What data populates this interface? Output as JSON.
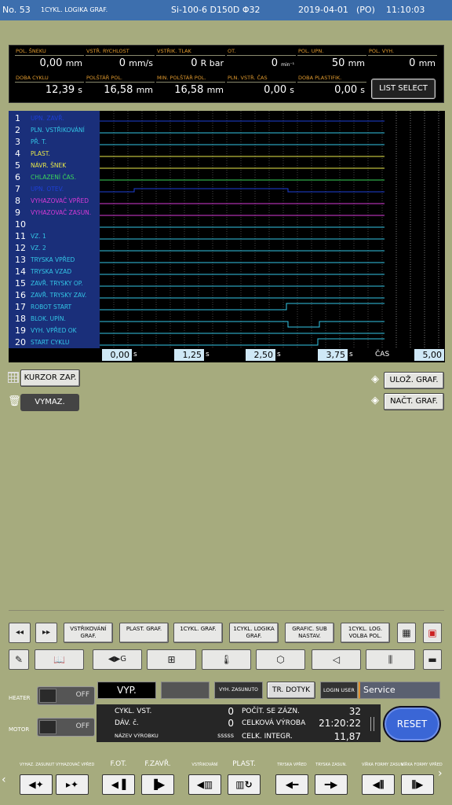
{
  "header": {
    "no": "No. 53",
    "mode": "1CYKL. LOGIKA GRAF.",
    "machine": "Si-100-6  D150D Φ32",
    "date": "2019-04-01",
    "day": "(PO)",
    "time": "11:10:03"
  },
  "params": [
    {
      "label": "POL. ŠNEKU",
      "value": "0,00",
      "unit": "mm"
    },
    {
      "label": "VSTŘ. RYCHLOST",
      "value": "0",
      "unit": "mm/s"
    },
    {
      "label": "VSTŘIK. TLAK",
      "value": "0",
      "unit": "R bar"
    },
    {
      "label": "OT.",
      "value": "0",
      "unit": "min⁻¹"
    },
    {
      "label": "POL. UPN.",
      "value": "50",
      "unit": "mm"
    },
    {
      "label": "POL. VYH.",
      "value": "0",
      "unit": "mm"
    },
    {
      "label": "DOBA CYKLU",
      "value": "12,39",
      "unit": "s"
    },
    {
      "label": "POLŠTÁŘ POL.",
      "value": "16,58",
      "unit": "mm"
    },
    {
      "label": "MIN. POLŠTÁŘ POL.",
      "value": "16,58",
      "unit": "mm"
    },
    {
      "label": "PLN. VSTŘ. ČAS",
      "value": "0,00",
      "unit": "s"
    },
    {
      "label": "DOBA PLASTIFIK.",
      "value": "0,00",
      "unit": "s"
    }
  ],
  "list_select": "LIST SELECT",
  "signals": [
    {
      "n": "1",
      "name": "UPN. ZAVŘ.",
      "color": "#1e3fd6"
    },
    {
      "n": "2",
      "name": "PLN. VSTŘIKOVÁNÍ",
      "color": "#33c6e6"
    },
    {
      "n": "3",
      "name": "PŘ. T.",
      "color": "#33c6e6"
    },
    {
      "n": "4",
      "name": "PLAST.",
      "color": "#e8e84a"
    },
    {
      "n": "5",
      "name": "NÁVR. ŠNEK",
      "color": "#e8e84a"
    },
    {
      "n": "6",
      "name": "CHLAZENÍ ČAS.",
      "color": "#3ad45a"
    },
    {
      "n": "7",
      "name": "UPN. OTEV.",
      "color": "#1e3fd6"
    },
    {
      "n": "8",
      "name": "VYHAZOVAČ VPŘED",
      "color": "#d63ad6"
    },
    {
      "n": "9",
      "name": "VYHAZOVAČ ZASUN.",
      "color": "#d63ad6"
    },
    {
      "n": "10",
      "name": "",
      "color": "#33c6e6"
    },
    {
      "n": "11",
      "name": "VZ. 1",
      "color": "#33c6e6"
    },
    {
      "n": "12",
      "name": "VZ. 2",
      "color": "#33c6e6"
    },
    {
      "n": "13",
      "name": "TRYSKA VPŘED",
      "color": "#33c6e6"
    },
    {
      "n": "14",
      "name": "TRYSKA VZAD",
      "color": "#33c6e6"
    },
    {
      "n": "15",
      "name": "ZAVŘ. TRYSKY OP.",
      "color": "#33c6e6"
    },
    {
      "n": "16",
      "name": "ZAVŘ. TRYSKY ZAV.",
      "color": "#33c6e6"
    },
    {
      "n": "17",
      "name": "ROBOT START",
      "color": "#33c6e6"
    },
    {
      "n": "18",
      "name": "BLOK. UPÍN.",
      "color": "#33c6e6"
    },
    {
      "n": "19",
      "name": "VYH. VPŘED OK",
      "color": "#33c6e6"
    },
    {
      "n": "20",
      "name": "START CYKLU",
      "color": "#33c6e6"
    }
  ],
  "time_axis": {
    "t0": "0,00",
    "t1": "1,25",
    "t2": "2,50",
    "t3": "3,75",
    "unit": "s",
    "cas_label": "ČAS",
    "cas_value": "5,00"
  },
  "tools": {
    "cursor": "KURZOR ZAP.",
    "delete": "VYMAZ.",
    "save": "ULOŽ. GRAF.",
    "load": "NAČT. GRAF."
  },
  "nav": {
    "prev": "◂◂",
    "next": "▸▸",
    "tabs": [
      "VSTŘIKOVÁNÍ GRAF.",
      "PLAST. GRAF.",
      "1CYKL. GRAF.",
      "1CYKL. LOGIKA GRAF.",
      "GRAFIC. SUB NASTAV.",
      "1CYKL. LOG. VOLBA POL."
    ]
  },
  "controls": {
    "heater": "HEATER",
    "heater_state": "OFF",
    "motor": "MOTOR",
    "motor_state": "OFF",
    "mode": "VYP.",
    "vyh": "VYH. ZASUNUTO",
    "tr": "TR. DOTYK",
    "login": "LOGIN USER",
    "user": "Service"
  },
  "status": {
    "cykl_label": "CYKL. VST.",
    "cykl_val": "0",
    "dav_label": "DÁV. č.",
    "dav_val": "0",
    "vyrobek_label": "NÁZEV VÝROBKU",
    "vyrobek_val": "sssss",
    "pocet_label": "POČÍT. SE ZÁZN.",
    "pocet_val": "32",
    "celk_label": "CELKOVÁ VÝROBA",
    "celk_val": "21:20:22",
    "integr_label": "CELK. INTEGR.",
    "integr_val": "11,87"
  },
  "reset": "RESET",
  "bottom": {
    "labels": [
      "VYHAZ. ZASUNUT",
      "VYHAZOVAČ VPŘED",
      "F.OT.",
      "F.ZAVŘ.",
      "VSTŘIKOVÁNÍ",
      "PLAST.",
      "TRYSKA VPŘED",
      "TRYSKA ZASUN.",
      "VÍŘKA FORMY ZASUN.",
      "VÍŘKA FORMY VPŘED"
    ]
  }
}
